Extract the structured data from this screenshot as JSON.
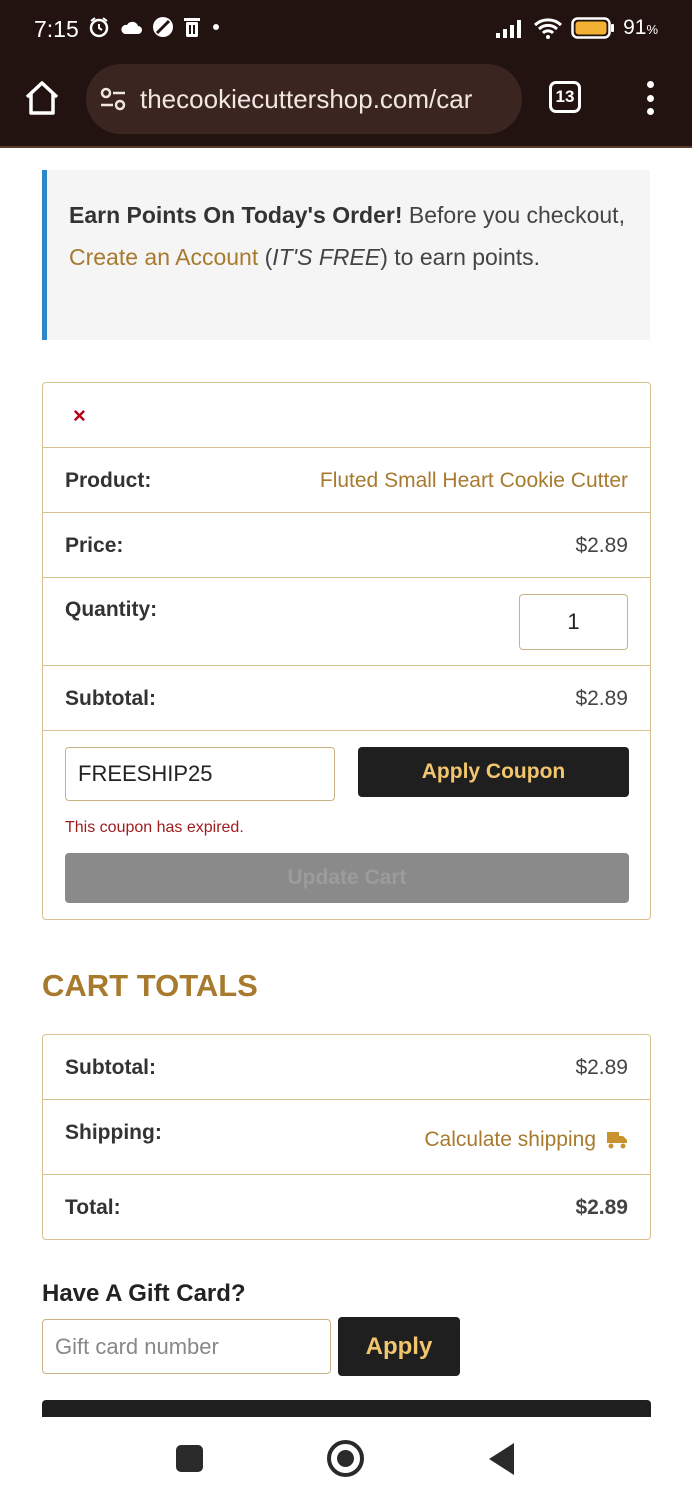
{
  "status_bar": {
    "time": "7:15",
    "battery_percent": "91",
    "battery_unit": "%"
  },
  "browser": {
    "url": "thecookiecuttershop.com/car",
    "tab_count": "13"
  },
  "points_banner": {
    "bold_text": "Earn Points On Today's Order!",
    "text_1": " Before you checkout, ",
    "link_text": "Create an Account",
    "text_2": " (",
    "italic_text": "IT'S FREE",
    "text_3": ") to earn points."
  },
  "cart": {
    "remove_symbol": "×",
    "product_label": "Product:",
    "product_name": "Fluted Small Heart Cookie Cutter",
    "price_label": "Price:",
    "price_value": "$2.89",
    "quantity_label": "Quantity:",
    "quantity_value": "1",
    "subtotal_label": "Subtotal:",
    "subtotal_value": "$2.89",
    "coupon_value": "FREESHIP25",
    "apply_coupon_label": "Apply Coupon",
    "coupon_error": "This coupon has expired.",
    "update_cart_label": "Update Cart"
  },
  "cart_totals": {
    "title": "CART TOTALS",
    "subtotal_label": "Subtotal:",
    "subtotal_value": "$2.89",
    "shipping_label": "Shipping:",
    "calculate_shipping": "Calculate shipping",
    "total_label": "Total:",
    "total_value": "$2.89"
  },
  "gift_card": {
    "title": "Have A Gift Card?",
    "placeholder": "Gift card number",
    "apply_label": "Apply"
  },
  "colors": {
    "accent_gold": "#a77a2e",
    "browser_bg": "#221311",
    "button_dark": "#1f1f1f",
    "button_text": "#f2c66e",
    "error_red": "#9e1c1c"
  }
}
